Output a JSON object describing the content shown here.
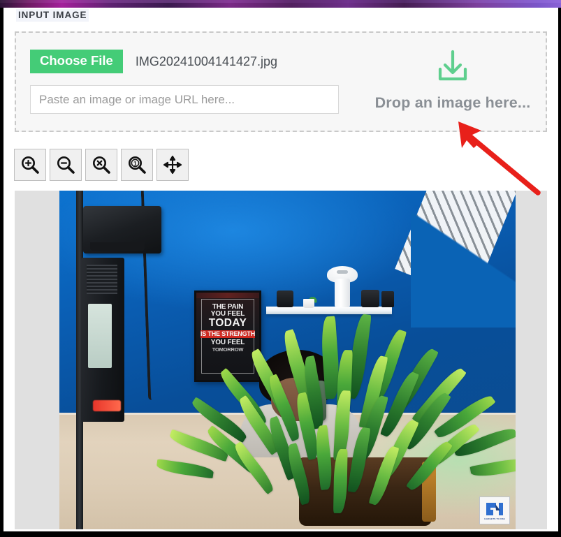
{
  "section": {
    "title": "INPUT IMAGE"
  },
  "upload": {
    "choose_file_label": "Choose File",
    "file_name": "IMG20241004141427.jpg",
    "url_input_value": "",
    "url_input_placeholder": "Paste an image or image URL here...",
    "drop_text": "Drop an image here...",
    "drop_icon": "download-arrow-icon",
    "accent_green": "#44cc77",
    "dashed_border_color": "#c9c9c9"
  },
  "toolbar": {
    "buttons": [
      {
        "name": "zoom-in-button",
        "icon": "magnifier-plus-icon",
        "title": "Zoom In"
      },
      {
        "name": "zoom-out-button",
        "icon": "magnifier-minus-icon",
        "title": "Zoom Out"
      },
      {
        "name": "zoom-reset-button",
        "icon": "magnifier-x-icon",
        "title": "Reset Zoom"
      },
      {
        "name": "zoom-actual-button",
        "icon": "magnifier-one-icon",
        "title": "Actual Size"
      },
      {
        "name": "pan-button",
        "icon": "move-arrows-icon",
        "title": "Pan"
      }
    ]
  },
  "viewer": {
    "background_color": "#e0e0e0",
    "photo_alt": "Studio room photo: green potted plant on a wooden desk in front of a blue wall, with studio light, shelf and a person holding a phone",
    "poster": {
      "line1": "THE PAIN",
      "line2": "YOU FEEL",
      "line3": "TODAY",
      "line4": "IS THE STRENGTH",
      "line5": "YOU FEEL",
      "line6": "TOMORROW"
    },
    "watermark": {
      "mark": "GT",
      "text": "GADGETS TO USE"
    }
  },
  "annotation": {
    "arrow_color": "#e8201a",
    "points_to": "Drop an image here..."
  }
}
